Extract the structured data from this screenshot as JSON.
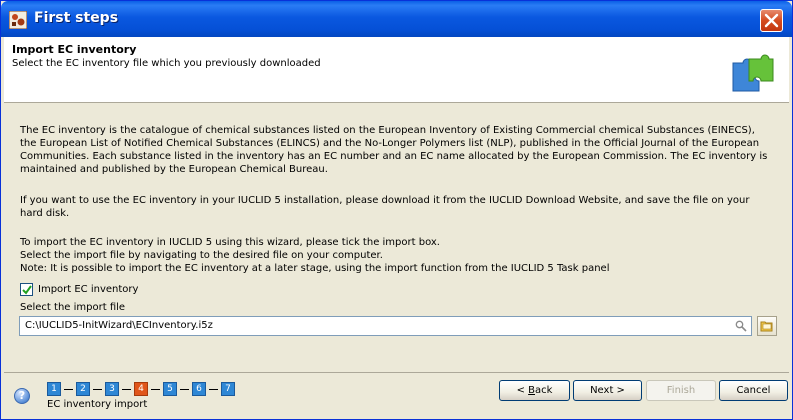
{
  "window": {
    "title": "First steps",
    "title_icon": "iuclid-app-icon",
    "close_icon": "close-icon"
  },
  "header": {
    "title": "Import EC inventory",
    "subtitle": "Select the EC inventory file which you previously downloaded",
    "icon": "puzzle-icon"
  },
  "content": {
    "paragraph1": "The EC inventory is the catalogue of chemical substances listed on the European Inventory of Existing Commercial chemical Substances (EINECS), the European List of Notified Chemical Substances (ELINCS) and the No-Longer Polymers list (NLP), published in the Official Journal of the European Communities. Each substance listed in the inventory has an EC number and an EC name allocated by the European Commission. The EC inventory is maintained and published by the European Chemical Bureau.",
    "paragraph2": "If you want to use the EC inventory in your IUCLID 5 installation, please download it from the IUCLID Download Website, and save the file on your hard disk.",
    "instruction1": "To import the EC inventory in IUCLID 5 using this wizard, please tick the import box.",
    "instruction2": "Select the import file by navigating to the desired file on your computer.",
    "instruction3": "Note: It is possible to import the EC inventory at a later stage, using the import function from the IUCLID 5 Task panel",
    "checkbox_label": "Import EC inventory",
    "checkbox_checked": true,
    "file_label": "Select the import file",
    "file_value": "C:\\IUCLID5-InitWizard\\ECInventory.i5z"
  },
  "footer": {
    "help_icon": "help-icon",
    "steps": [
      "1",
      "2",
      "3",
      "4",
      "5",
      "6",
      "7"
    ],
    "current_step": 4,
    "step_label": "EC inventory import",
    "back_label": "Back",
    "back_mnemonic": "B",
    "next_label": "Next >",
    "finish_label": "Finish",
    "cancel_label": "Cancel"
  },
  "colors": {
    "titlebar": "#0a58e0",
    "step_active": "#2e87d5",
    "step_current": "#e0561a"
  }
}
